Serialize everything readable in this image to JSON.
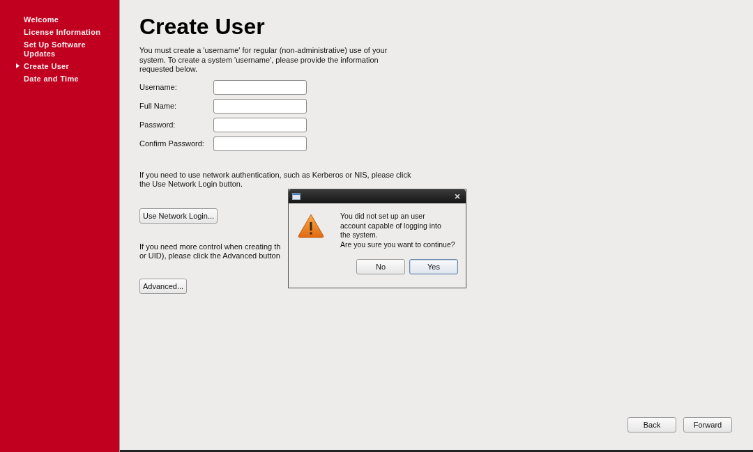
{
  "sidebar": {
    "items": [
      {
        "label": "Welcome",
        "selected": false
      },
      {
        "label": "License Information",
        "selected": false
      },
      {
        "label": "Set Up Software Updates",
        "selected": false
      },
      {
        "label": "Create User",
        "selected": true
      },
      {
        "label": "Date and Time",
        "selected": false
      }
    ]
  },
  "page": {
    "title": "Create User",
    "intro": [
      "You must create a 'username' for regular (non-administrative) use of your",
      "system.  To create a system 'username', please provide the information",
      "requested below."
    ],
    "fields": [
      {
        "label": "Username:"
      },
      {
        "label": "Full Name:"
      },
      {
        "label": "Password:"
      },
      {
        "label": "Confirm Password:"
      }
    ],
    "network_text": [
      "If you need to use network authentication, such as Kerberos or NIS, please click",
      "the Use Network Login button."
    ],
    "network_button": "Use Network Login...",
    "advanced_text": [
      "If you need more control when creating th",
      "or UID), please click the Advanced button"
    ],
    "advanced_button": "Advanced..."
  },
  "nav_buttons": [
    {
      "label": "Back"
    },
    {
      "label": "Forward"
    }
  ],
  "dialog": {
    "message": [
      "You did not set up an user",
      "account capable of logging into",
      "the system.",
      "Are you sure you want to continue?"
    ],
    "buttons": [
      {
        "label": "No",
        "default": false
      },
      {
        "label": "Yes",
        "default": true
      }
    ]
  }
}
